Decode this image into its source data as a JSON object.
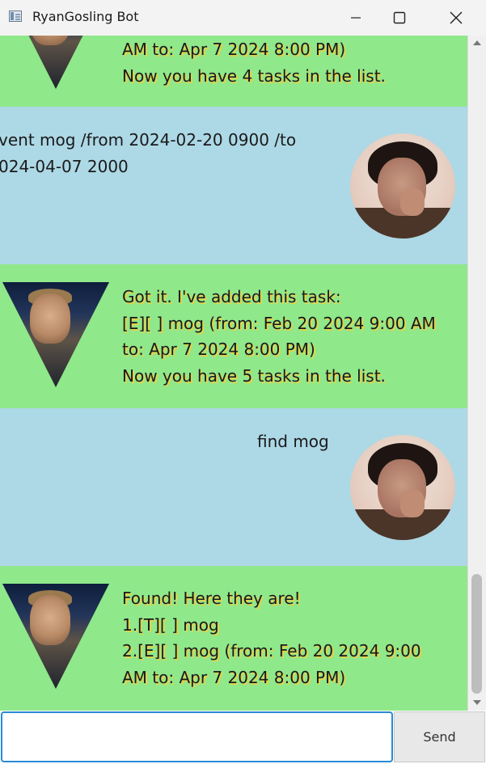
{
  "window": {
    "title": "RyanGosling Bot"
  },
  "chat": {
    "messages": [
      {
        "sender": "bot",
        "text": "AM to: Apr 7 2024 8:00 PM)\nNow you have 4 tasks in the list."
      },
      {
        "sender": "user",
        "text": "vent mog /from 2024-02-20 0900 /to\n024-04-07 2000"
      },
      {
        "sender": "bot",
        "text": "Got it. I've added this task:\n[E][ ] mog (from: Feb 20 2024 9:00 AM\nto: Apr 7 2024 8:00 PM)\nNow you have 5 tasks in the list."
      },
      {
        "sender": "user",
        "text": "find mog"
      },
      {
        "sender": "bot",
        "text": "Found! Here they are!\n1.[T][ ] mog\n2.[E][ ] mog (from: Feb 20 2024 9:00\nAM to: Apr 7 2024 8:00 PM)"
      }
    ]
  },
  "input": {
    "value": "",
    "placeholder": ""
  },
  "send_button": {
    "label": "Send"
  },
  "colors": {
    "bot_bubble": "#8fe88a",
    "user_bubble": "#add8e6",
    "text_highlight": "#e6d24a",
    "input_focus": "#2a8ad6"
  },
  "icons": {
    "app": "app-window-icon",
    "minimize": "minimize-icon",
    "maximize": "maximize-icon",
    "close": "close-icon"
  }
}
